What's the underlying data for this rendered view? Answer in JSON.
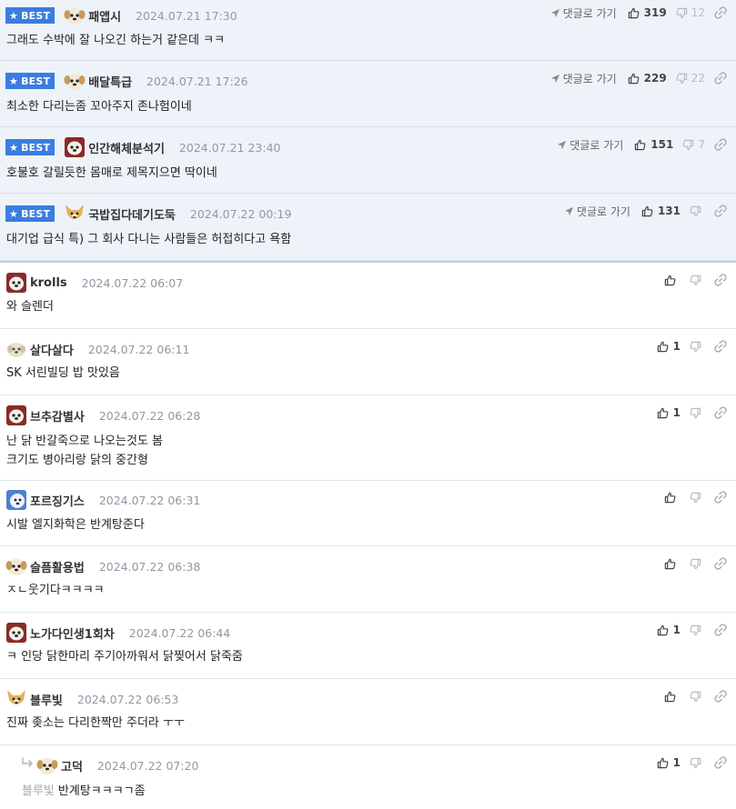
{
  "ui": {
    "best_label": "BEST",
    "goto_label": "댓글로 가기"
  },
  "comments": [
    {
      "nick": "패앱시",
      "date": "2024.07.21 17:30",
      "text": [
        "그래도 수박에 잘 나오긴 하는거 같은데 ㅋㅋ"
      ],
      "up": "319",
      "down": "12",
      "avatar": "dog-avatar"
    },
    {
      "nick": "배달특급",
      "date": "2024.07.21 17:26",
      "text": [
        "최소한 다리는좀 꼬아주지 존나험이네"
      ],
      "up": "229",
      "down": "22",
      "avatar": "dog-avatar"
    },
    {
      "nick": "인간해체분석기",
      "date": "2024.07.21 23:40",
      "text": [
        "호불호 갈릴듯한 몸매로 제목지으면 딱이네"
      ],
      "up": "151",
      "down": "7",
      "avatar": "red-dog-avatar"
    },
    {
      "nick": "국밥집다데기도둑",
      "date": "2024.07.22 00:19",
      "text": [
        "대기업 급식 특) 그 회사 다니는 사람들은 허접히다고 욕함"
      ],
      "up": "131",
      "down": "",
      "avatar": "fox-avatar"
    },
    {
      "nick": "krolls",
      "date": "2024.07.22 06:07",
      "text": [
        "와 슬렌더"
      ],
      "up": "",
      "down": "",
      "avatar": "red-dog-avatar"
    },
    {
      "nick": "살다살다",
      "date": "2024.07.22 06:11",
      "text": [
        "SK 서린빌딩 밥 맛있음"
      ],
      "up": "1",
      "down": "",
      "avatar": "pale-dog-avatar"
    },
    {
      "nick": "브추감별사",
      "date": "2024.07.22 06:28",
      "text": [
        "난 닭 반갈죽으로 나오는것도 봄",
        "크기도 병아리랑 닭의 중간형"
      ],
      "up": "1",
      "down": "",
      "avatar": "red-dog-avatar"
    },
    {
      "nick": "포르징기스",
      "date": "2024.07.22 06:31",
      "text": [
        "시발 엘지화학은 반계탕준다"
      ],
      "up": "",
      "down": "",
      "avatar": "blue-dog-avatar"
    },
    {
      "nick": "슬픔활용법",
      "date": "2024.07.22 06:38",
      "text": [
        "ㅈㄴ웃기다ㅋㅋㅋㅋ"
      ],
      "up": "",
      "down": "",
      "avatar": "dog-avatar"
    },
    {
      "nick": "노가다인생1회차",
      "date": "2024.07.22 06:44",
      "text": [
        "ㅋ 인당 닭한마리 주기아까워서 닭찢어서 닭죽줌"
      ],
      "up": "1",
      "down": "",
      "avatar": "red-dog-avatar"
    },
    {
      "nick": "블루빛",
      "date": "2024.07.22 06:53",
      "text": [
        "진짜 좆소는 다리한짝만 주더라 ㅜㅜ"
      ],
      "up": "",
      "down": "",
      "avatar": "fox-avatar"
    },
    {
      "nick": "고덕",
      "date": "2024.07.22 07:20",
      "mention": "블루빛",
      "text": [
        "반계탕ㅋㅋㅋㄱ좀"
      ],
      "up": "1",
      "down": "",
      "avatar": "dog-avatar"
    }
  ],
  "colors": {
    "best_bg": "#eef3fa",
    "badge": "#3b7de0",
    "date": "#9098a3",
    "divider": "#e3e6ea"
  }
}
